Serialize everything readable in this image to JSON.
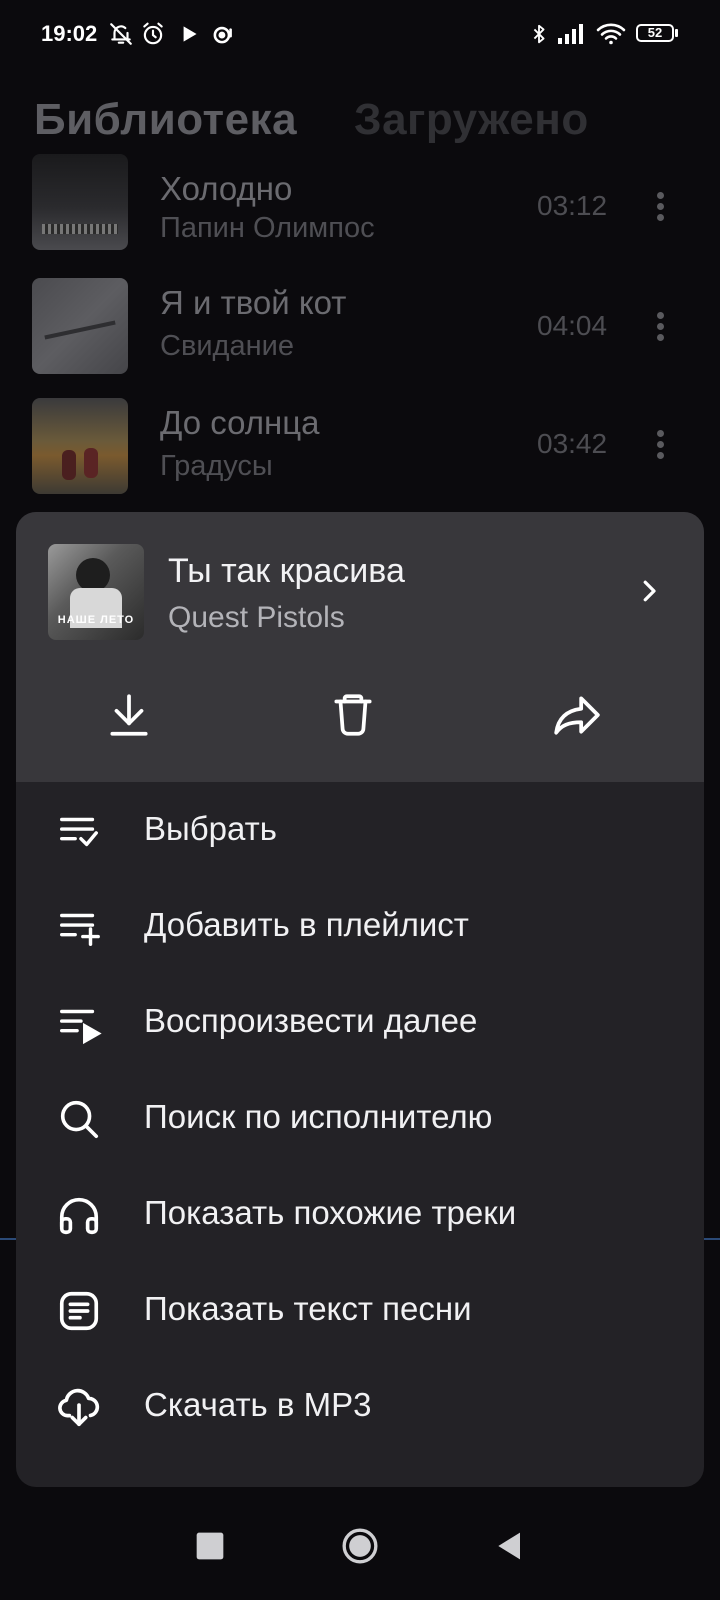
{
  "status_bar": {
    "time": "19:02",
    "battery": "52",
    "icons": [
      "bell-muted-icon",
      "alarm-icon",
      "play-icon",
      "headset-icon",
      "bluetooth-icon",
      "signal-icon",
      "wifi-icon",
      "battery-icon"
    ]
  },
  "library": {
    "tabs": [
      {
        "label": "Библиотека",
        "active": true
      },
      {
        "label": "Загружено",
        "active": false
      }
    ],
    "tracks": [
      {
        "title": "Холодно",
        "artist": "Папин Олимпос",
        "duration": "03:12"
      },
      {
        "title": "Я и твой кот",
        "artist": "Свидание",
        "duration": "04:04"
      },
      {
        "title": "До солнца",
        "artist": "Градусы",
        "duration": "03:42"
      }
    ]
  },
  "sheet": {
    "track": {
      "title": "Ты так красива",
      "artist": "Quest Pistols",
      "cover_text": "НАШЕ ЛЕТО"
    },
    "actions": [
      {
        "name": "download",
        "icon": "download-icon"
      },
      {
        "name": "delete",
        "icon": "trash-icon"
      },
      {
        "name": "share",
        "icon": "share-icon"
      }
    ],
    "menu": [
      {
        "label": "Выбрать",
        "icon": "select-list-icon"
      },
      {
        "label": "Добавить в плейлист",
        "icon": "playlist-add-icon"
      },
      {
        "label": "Воспроизвести далее",
        "icon": "play-next-icon"
      },
      {
        "label": "Поиск по исполнителю",
        "icon": "search-icon"
      },
      {
        "label": "Показать похожие треки",
        "icon": "headphones-icon"
      },
      {
        "label": "Показать текст песни",
        "icon": "lyrics-icon"
      },
      {
        "label": "Скачать в MP3",
        "icon": "cloud-download-icon"
      }
    ]
  },
  "colors": {
    "background": "#0b0a0d",
    "sheet_header": "#38373b",
    "sheet_body": "#232226",
    "text_primary": "#f1f1f3",
    "text_secondary": "#b3b3b8"
  }
}
